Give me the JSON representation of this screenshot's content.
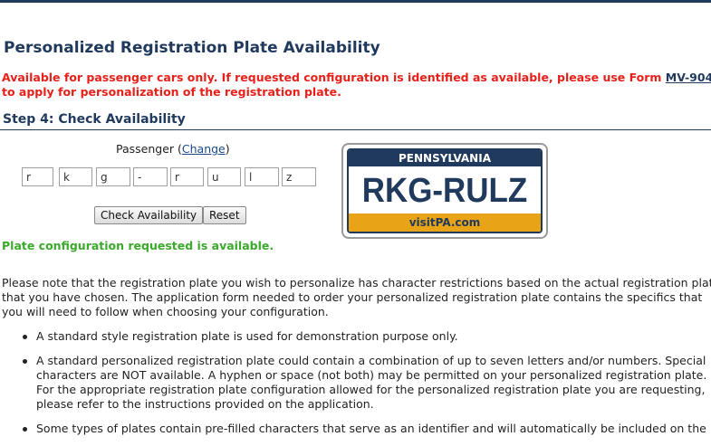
{
  "page": {
    "title": "Personalized Registration Plate Availability",
    "notice_part1": "Available for passenger cars only. If requested configuration is identified as available, please use Form ",
    "notice_link": "MV-904",
    "notice_part2": " to apply for personalization of the registration plate.",
    "step_heading": "Step 4: Check Availability"
  },
  "form": {
    "plate_type_label": "Passenger (",
    "plate_type_link": "Change",
    "plate_type_close": ")",
    "characters": [
      "r",
      "k",
      "g",
      "-",
      "r",
      "u",
      "l",
      "z"
    ],
    "check_button": "Check Availability",
    "reset_button": "Reset"
  },
  "plate": {
    "state": "PENNSYLVANIA",
    "number": "RKG-RULZ",
    "footer": "visitPA.com",
    "colors": {
      "navy": "#1f3a5c",
      "gold": "#e8a317"
    }
  },
  "result": {
    "message": "Plate configuration requested is available.",
    "color": "#3aaa2a"
  },
  "info": {
    "paragraph": "Please note that the registration plate you wish to personalize has character restrictions based on the actual registration plate that you have chosen. The application form needed to order your personalized registration plate contains the specifics that you will need to follow when choosing your configuration.",
    "bullets": [
      "A standard style registration plate is used for demonstration purpose only.",
      "A standard personalized registration plate could contain a combination of up to seven letters and/or numbers. Special characters are NOT available. A hyphen or space (not both) may be permitted on your personalized registration plate. For the appropriate registration plate configuration allowed for the personalized registration plate you are requesting, please refer to the instructions provided on the application.",
      "Some types of plates contain pre-filled characters that serve as an identifier and will automatically be included on the"
    ]
  }
}
